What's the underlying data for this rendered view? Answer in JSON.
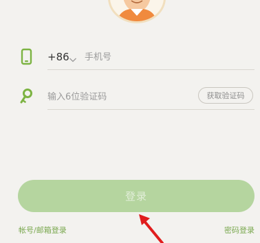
{
  "phone": {
    "country_code": "+86",
    "placeholder": "手机号",
    "value": ""
  },
  "verification": {
    "placeholder": "输入6位验证码",
    "value": "",
    "get_code_label": "获取验证码"
  },
  "login_button_label": "登录",
  "links": {
    "account_email_login": "帐号/邮箱登录",
    "password_login": "密码登录"
  },
  "icons": {
    "phone": "phone-icon",
    "key": "key-icon",
    "chevron": "chevron-down-icon",
    "arrow": "arrow-annotation-icon"
  },
  "colors": {
    "accent_green": "#7cb342",
    "button_green": "#b5d59f",
    "annotation_red": "#e01d1d",
    "background": "#f3f2ef"
  }
}
